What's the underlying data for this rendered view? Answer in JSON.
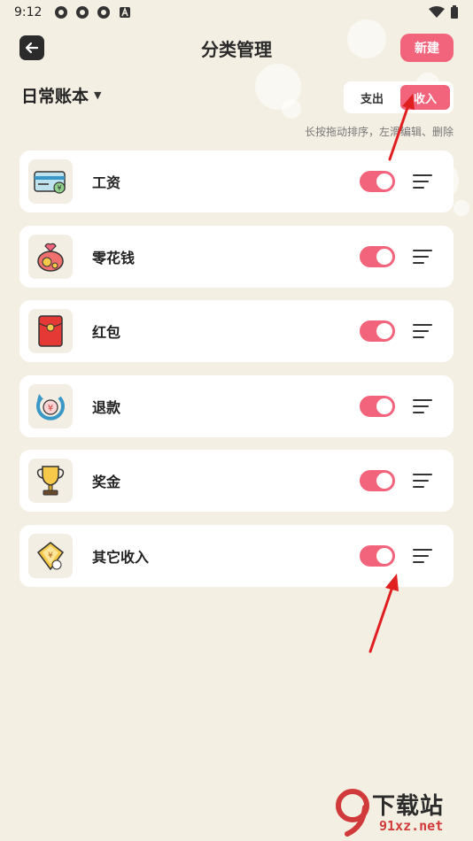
{
  "status_bar": {
    "time": "9:12",
    "left_icons": [
      "app-notification-icon",
      "app-notification-icon",
      "app-notification-icon",
      "font-a-icon"
    ],
    "right_icons": [
      "wifi-icon",
      "battery-icon"
    ]
  },
  "header": {
    "title": "分类管理",
    "new_label": "新建"
  },
  "account_book": {
    "label": "日常账本",
    "caret": "▼"
  },
  "tabs": [
    {
      "label": "支出",
      "active": false
    },
    {
      "label": "收入",
      "active": true
    }
  ],
  "hint": "长按拖动排序，左滑编辑、删除",
  "categories": [
    {
      "name": "工资",
      "icon": "card-money-icon",
      "enabled": true
    },
    {
      "name": "零花钱",
      "icon": "money-bag-icon",
      "enabled": true
    },
    {
      "name": "红包",
      "icon": "red-envelope-icon",
      "enabled": true
    },
    {
      "name": "退款",
      "icon": "refund-icon",
      "enabled": true
    },
    {
      "name": "奖金",
      "icon": "trophy-icon",
      "enabled": true
    },
    {
      "name": "其它收入",
      "icon": "other-income-icon",
      "enabled": true
    }
  ],
  "watermark": {
    "title": "下载站",
    "domain": "91xz.net"
  },
  "colors": {
    "accent": "#f2637c",
    "background": "#f4efe3",
    "card": "#ffffff",
    "annotation_arrow": "#e02020"
  }
}
